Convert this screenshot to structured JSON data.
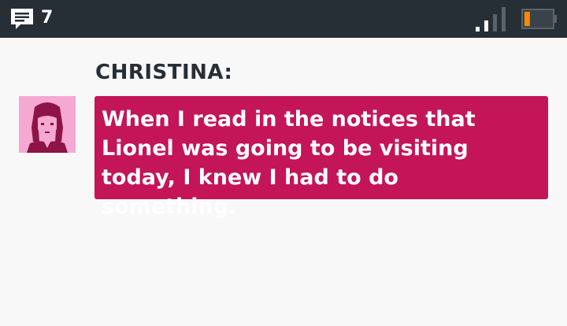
{
  "status_bar": {
    "message_count": "7",
    "icons": {
      "messages": "message-bubble-icon",
      "signal": "signal-strength-icon",
      "battery": "battery-low-icon"
    },
    "colors": {
      "background": "#262e36",
      "battery_level": "#ff8a00"
    },
    "battery_level": 0.2,
    "signal_bars_active": 2,
    "signal_bars_total": 4
  },
  "dialogue": {
    "speaker": "CHRISTINA:",
    "text": "When I read in the notices that Lionel was going to be visiting today, I knew I had to do something.",
    "colors": {
      "bubble": "#c31557",
      "avatar_bg": "#f5a8d2",
      "avatar_line": "#8e1346"
    }
  }
}
